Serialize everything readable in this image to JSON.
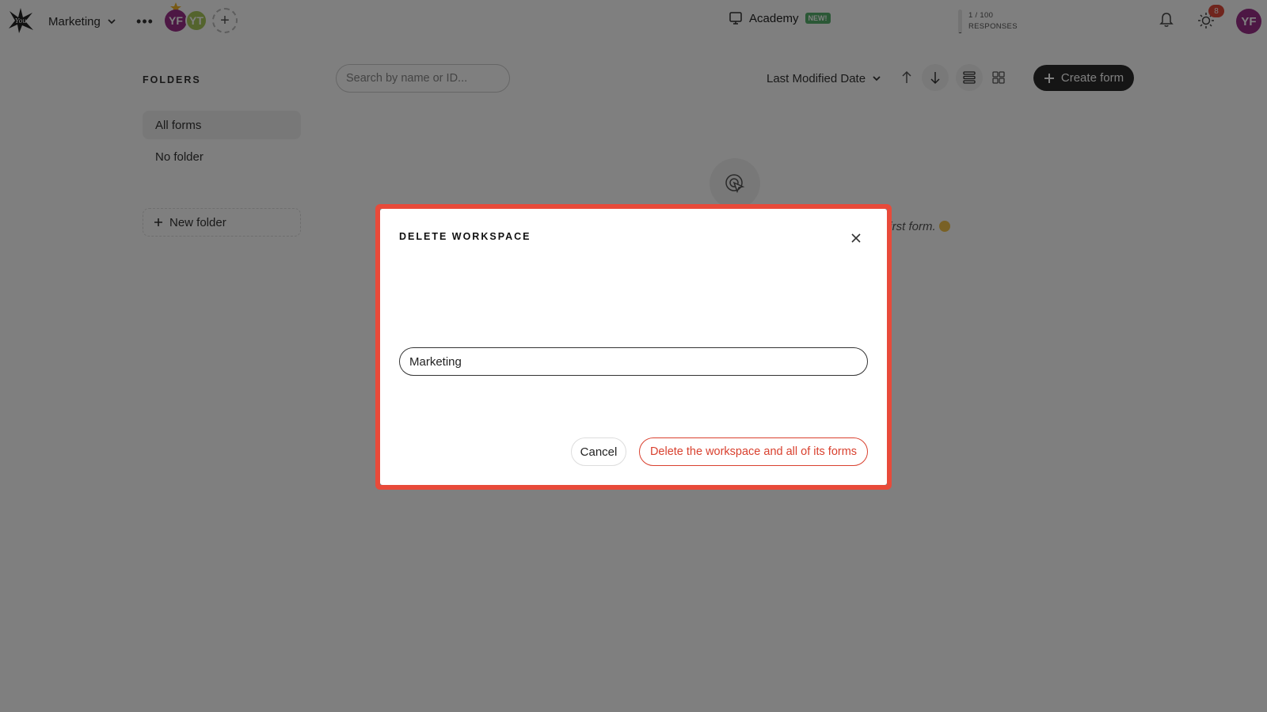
{
  "topbar": {
    "workspace_name": "Marketing",
    "more_label": "•••",
    "avatars": [
      {
        "initials": "YF",
        "color": "#9b2e89"
      },
      {
        "initials": "YT",
        "color": "#a8c85a"
      }
    ],
    "add_member_label": "+",
    "academy_label": "Academy",
    "academy_badge": "NEW!",
    "responses_count": "1 / 100",
    "responses_label": "RESPONSES",
    "responses_fraction": 0.01,
    "notification_count": "8",
    "user_initials": "YF"
  },
  "sidebar": {
    "title": "FOLDERS",
    "items": [
      {
        "label": "All forms",
        "active": true
      },
      {
        "label": "No folder",
        "active": false
      }
    ],
    "new_folder_label": "New folder"
  },
  "toolbar": {
    "search_placeholder": "Search by name or ID...",
    "sort_label": "Last Modified Date",
    "create_label": "Create form"
  },
  "empty_state": {
    "text": "r first form."
  },
  "modal": {
    "title": "DELETE WORKSPACE",
    "input_value": "Marketing",
    "cancel_label": "Cancel",
    "delete_label": "Delete the workspace and all of its forms",
    "highlight_color": "#e84a3a",
    "danger_color": "#d9412f"
  },
  "icons": {
    "logo": "star-splat-logo-icon",
    "chevron": "chevron-down-icon",
    "academy": "academy-icon",
    "bell": "bell-icon",
    "theme": "sun-icon",
    "sort_up": "arrow-up-icon",
    "sort_down": "arrow-down-icon",
    "list": "list-view-icon",
    "grid": "grid-view-icon",
    "plus": "plus-icon",
    "close": "close-icon",
    "empty": "click-target-icon"
  }
}
